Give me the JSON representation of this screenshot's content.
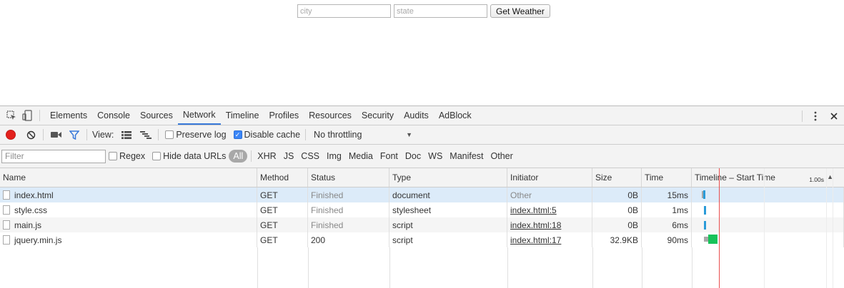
{
  "page": {
    "city_placeholder": "city",
    "state_placeholder": "state",
    "button_label": "Get Weather"
  },
  "devtools": {
    "tabs": [
      "Elements",
      "Console",
      "Sources",
      "Network",
      "Timeline",
      "Profiles",
      "Resources",
      "Security",
      "Audits",
      "AdBlock"
    ],
    "active_tab": "Network",
    "toolbar": {
      "view_label": "View:",
      "preserve_log": "Preserve log",
      "preserve_log_checked": false,
      "disable_cache": "Disable cache",
      "disable_cache_checked": true,
      "throttle": "No throttling"
    },
    "filter": {
      "placeholder": "Filter",
      "regex": "Regex",
      "hide_data_urls": "Hide data URLs",
      "types": [
        "All",
        "XHR",
        "JS",
        "CSS",
        "Img",
        "Media",
        "Font",
        "Doc",
        "WS",
        "Manifest",
        "Other"
      ],
      "active_type": "All"
    },
    "columns": {
      "name": "Name",
      "method": "Method",
      "status": "Status",
      "type": "Type",
      "initiator": "Initiator",
      "size": "Size",
      "time": "Time",
      "timeline": "Timeline – Start Time",
      "timeline_scale": "1.00s"
    },
    "rows": [
      {
        "name": "index.html",
        "method": "GET",
        "status": "Finished",
        "type": "document",
        "initiator": "Other",
        "size": "0B",
        "time": "15ms"
      },
      {
        "name": "style.css",
        "method": "GET",
        "status": "Finished",
        "type": "stylesheet",
        "initiator": "index.html:5",
        "size": "0B",
        "time": "1ms"
      },
      {
        "name": "main.js",
        "method": "GET",
        "status": "Finished",
        "type": "script",
        "initiator": "index.html:18",
        "size": "0B",
        "time": "6ms"
      },
      {
        "name": "jquery.min.js",
        "method": "GET",
        "status": "200",
        "type": "script",
        "initiator": "index.html:17",
        "size": "32.9KB",
        "time": "90ms"
      }
    ],
    "colors": {
      "accent": "#3879d9",
      "record": "#e3211d",
      "bar_blue": "#2a9bd8",
      "bar_green": "#17c35a",
      "bar_wait": "#a8a8a8",
      "load_line": "#e94f4f"
    }
  }
}
